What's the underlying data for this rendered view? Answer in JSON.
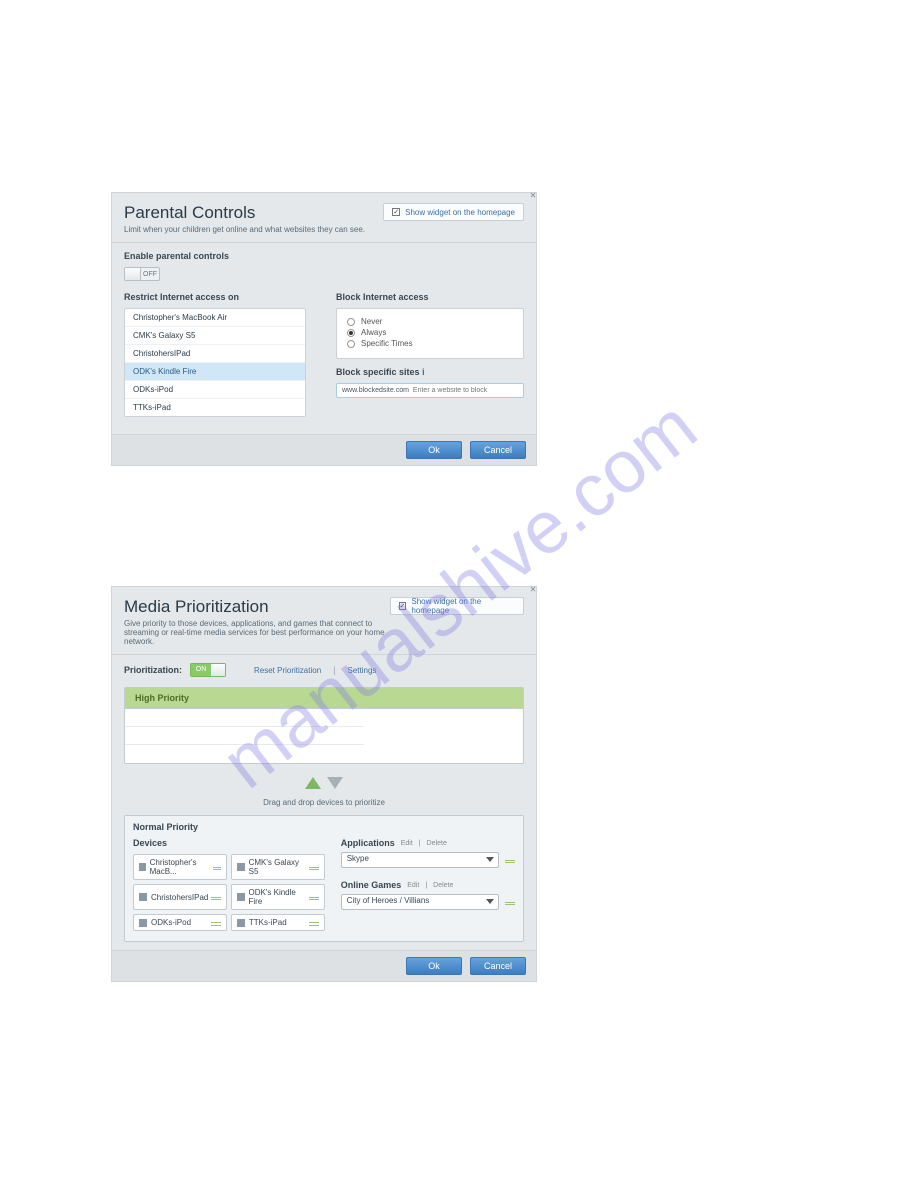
{
  "watermark": "manualshive.com",
  "parental": {
    "title": "Parental Controls",
    "subtitle": "Limit when your children get online and what websites they can see.",
    "show_widget_label": "Show widget on the homepage",
    "enable_label": "Enable parental controls",
    "toggle_state": "OFF",
    "restrict_label": "Restrict Internet access on",
    "devices": [
      {
        "name": "Christopher's MacBook Air",
        "selected": false
      },
      {
        "name": "CMK's Galaxy S5",
        "selected": false
      },
      {
        "name": "ChristohersIPad",
        "selected": false
      },
      {
        "name": "ODK's Kindle Fire",
        "selected": true
      },
      {
        "name": "ODKs-iPod",
        "selected": false
      },
      {
        "name": "TTKs-iPad",
        "selected": false
      }
    ],
    "block_access_label": "Block Internet access",
    "radios": [
      {
        "label": "Never",
        "checked": false
      },
      {
        "label": "Always",
        "checked": true
      },
      {
        "label": "Specific Times",
        "checked": false
      }
    ],
    "block_sites_label": "Block specific sites",
    "blocked_example": "www.blockedsite.com",
    "block_input_placeholder": "Enter a website to block",
    "ok": "Ok",
    "cancel": "Cancel"
  },
  "media": {
    "title": "Media Prioritization",
    "subtitle": "Give priority to those devices, applications, and games that connect to streaming or real-time media services for best performance on your home network.",
    "show_widget_label": "Show widget on the homepage",
    "prioritization_label": "Prioritization:",
    "toggle_state": "ON",
    "reset_link": "Reset Prioritization",
    "settings_link": "Settings",
    "high_label": "High Priority",
    "drag_hint": "Drag and drop devices to prioritize",
    "normal_label": "Normal Priority",
    "devices_label": "Devices",
    "devices": [
      "Christopher's MacB...",
      "CMK's Galaxy S5",
      "ChristohersIPad",
      "ODK's Kindle Fire",
      "ODKs-iPod",
      "TTKs-iPad"
    ],
    "apps_label": "Applications",
    "edit": "Edit",
    "delete": "Delete",
    "app_selected": "Skype",
    "games_label": "Online Games",
    "game_selected": "City of Heroes / Villians",
    "ok": "Ok",
    "cancel": "Cancel"
  }
}
